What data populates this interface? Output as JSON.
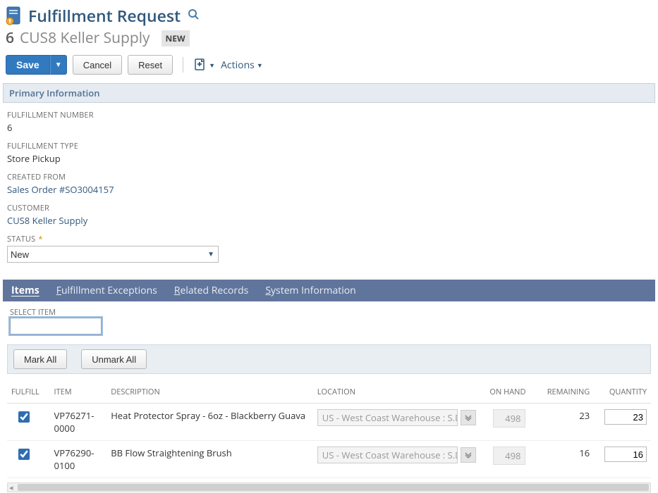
{
  "header": {
    "title": "Fulfillment Request",
    "record_id": "6",
    "record_name": "CUS8 Keller Supply",
    "status_badge": "NEW"
  },
  "actions": {
    "save": "Save",
    "cancel": "Cancel",
    "reset": "Reset",
    "actions_label": "Actions"
  },
  "primary_section_title": "Primary Information",
  "fields": {
    "fulfillment_number": {
      "label": "FULFILLMENT NUMBER",
      "value": "6"
    },
    "fulfillment_type": {
      "label": "FULFILLMENT TYPE",
      "value": "Store Pickup"
    },
    "created_from": {
      "label": "CREATED FROM",
      "value": "Sales Order #SO3004157"
    },
    "customer": {
      "label": "CUSTOMER",
      "value": "CUS8 Keller Supply"
    },
    "status": {
      "label": "STATUS",
      "value": "New"
    }
  },
  "tabs": [
    "Items",
    "Fulfillment Exceptions",
    "Related Records",
    "System Information"
  ],
  "subform": {
    "select_item_label": "SELECT ITEM",
    "select_item_value": "",
    "mark_all": "Mark All",
    "unmark_all": "Unmark All"
  },
  "columns": {
    "fulfill": "FULFILL",
    "item": "ITEM",
    "description": "DESCRIPTION",
    "location": "LOCATION",
    "on_hand": "ON HAND",
    "remaining": "REMAINING",
    "quantity": "QUANTITY"
  },
  "rows": [
    {
      "fulfill": true,
      "item": "VP76271-0000",
      "description": "Heat Protector Spray - 6oz - Blackberry Guava",
      "location": "US - West Coast Warehouse : S.D",
      "on_hand": "498",
      "remaining": "23",
      "quantity": "23"
    },
    {
      "fulfill": true,
      "item": "VP76290-0100",
      "description": "BB Flow Straightening Brush",
      "location": "US - West Coast Warehouse : S.D",
      "on_hand": "498",
      "remaining": "16",
      "quantity": "16"
    }
  ]
}
